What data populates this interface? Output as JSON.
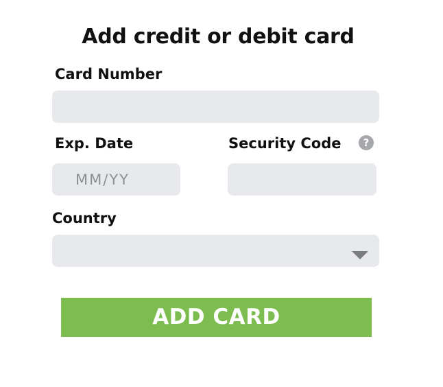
{
  "form": {
    "title": "Add credit or debit card",
    "card_number": {
      "label": "Card Number",
      "value": "",
      "placeholder": ""
    },
    "exp_date": {
      "label": "Exp. Date",
      "value": "",
      "placeholder": "MM/YY"
    },
    "security_code": {
      "label": "Security Code",
      "value": "",
      "placeholder": "",
      "help_icon": "question-mark-icon",
      "help_glyph": "?"
    },
    "country": {
      "label": "Country",
      "selected": "",
      "dropdown_icon": "chevron-down-icon"
    },
    "submit_label": "ADD CARD"
  },
  "colors": {
    "field_background": "#e8e9ec",
    "button_green": "#7dbd50",
    "help_icon_gray": "#a7a8ab",
    "text": "#111111"
  }
}
